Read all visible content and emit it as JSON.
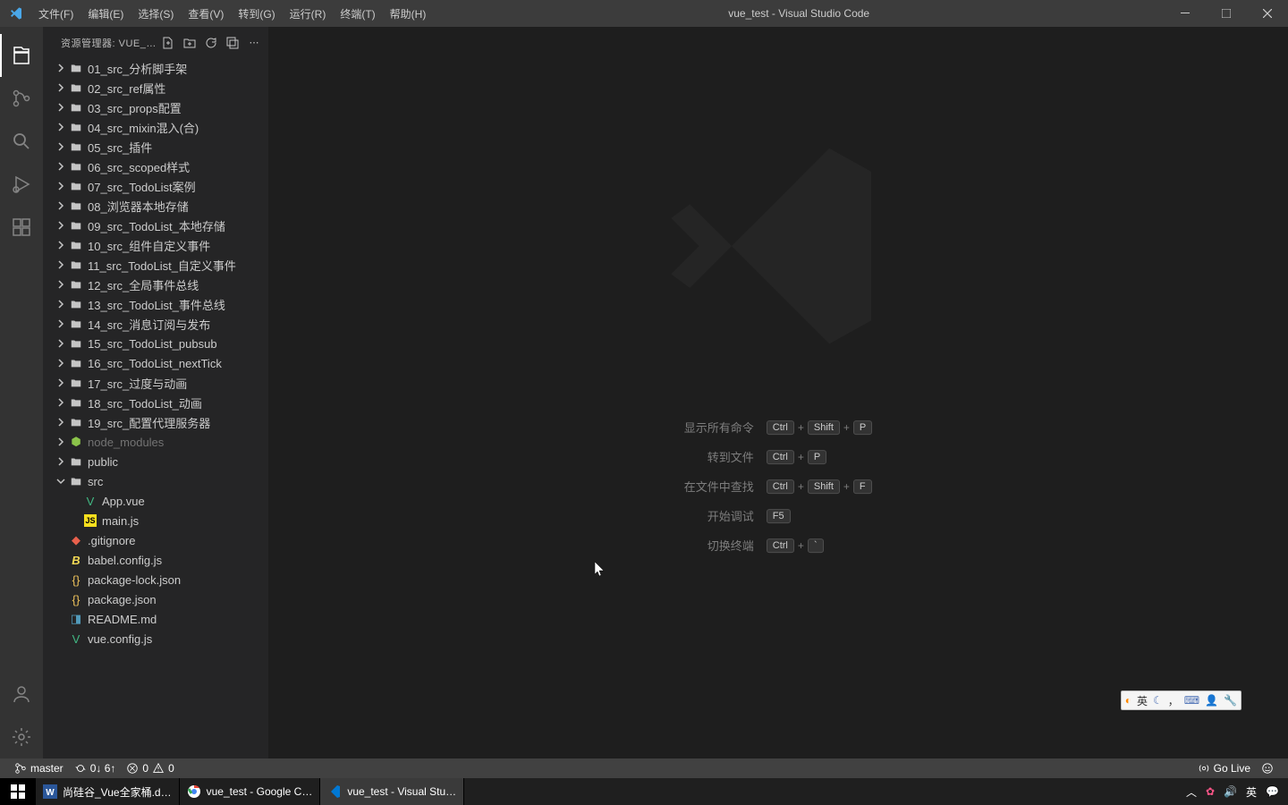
{
  "title": "vue_test - Visual Studio Code",
  "menubar": [
    "文件(F)",
    "编辑(E)",
    "选择(S)",
    "查看(V)",
    "转到(G)",
    "运行(R)",
    "终端(T)",
    "帮助(H)"
  ],
  "sidebar": {
    "header": "资源管理器: VUE_T…",
    "folders": [
      "01_src_分析脚手架",
      "02_src_ref属性",
      "03_src_props配置",
      "04_src_mixin混入(合)",
      "05_src_插件",
      "06_src_scoped样式",
      "07_src_TodoList案例",
      "08_浏览器本地存储",
      "09_src_TodoList_本地存储",
      "10_src_组件自定义事件",
      "11_src_TodoList_自定义事件",
      "12_src_全局事件总线",
      "13_src_TodoList_事件总线",
      "14_src_消息订阅与发布",
      "15_src_TodoList_pubsub",
      "16_src_TodoList_nextTick",
      "17_src_过度与动画",
      "18_src_TodoList_动画",
      "19_src_配置代理服务器"
    ],
    "node_modules": "node_modules",
    "public": "public",
    "src": "src",
    "src_children": [
      "App.vue",
      "main.js"
    ],
    "root_files": [
      {
        "name": ".gitignore",
        "type": "git"
      },
      {
        "name": "babel.config.js",
        "type": "babel"
      },
      {
        "name": "package-lock.json",
        "type": "json"
      },
      {
        "name": "package.json",
        "type": "json"
      },
      {
        "name": "README.md",
        "type": "md"
      },
      {
        "name": "vue.config.js",
        "type": "vue"
      }
    ]
  },
  "shortcuts": [
    {
      "label": "显示所有命令",
      "keys": [
        "Ctrl",
        "Shift",
        "P"
      ]
    },
    {
      "label": "转到文件",
      "keys": [
        "Ctrl",
        "P"
      ]
    },
    {
      "label": "在文件中查找",
      "keys": [
        "Ctrl",
        "Shift",
        "F"
      ]
    },
    {
      "label": "开始调试",
      "keys": [
        "F5"
      ]
    },
    {
      "label": "切换终端",
      "keys": [
        "Ctrl",
        "`"
      ]
    }
  ],
  "statusbar": {
    "branch": "master",
    "sync": "0↓ 6↑",
    "errors": "0",
    "warnings": "0",
    "golive": "Go Live"
  },
  "taskbar": {
    "items": [
      {
        "label": "尚硅谷_Vue全家桶.d…",
        "icon": "word"
      },
      {
        "label": "vue_test - Google C…",
        "icon": "chrome"
      },
      {
        "label": "vue_test - Visual Stu…",
        "icon": "vscode",
        "active": true
      }
    ],
    "tray_lang": "英"
  },
  "ime": {
    "lang": "英"
  }
}
